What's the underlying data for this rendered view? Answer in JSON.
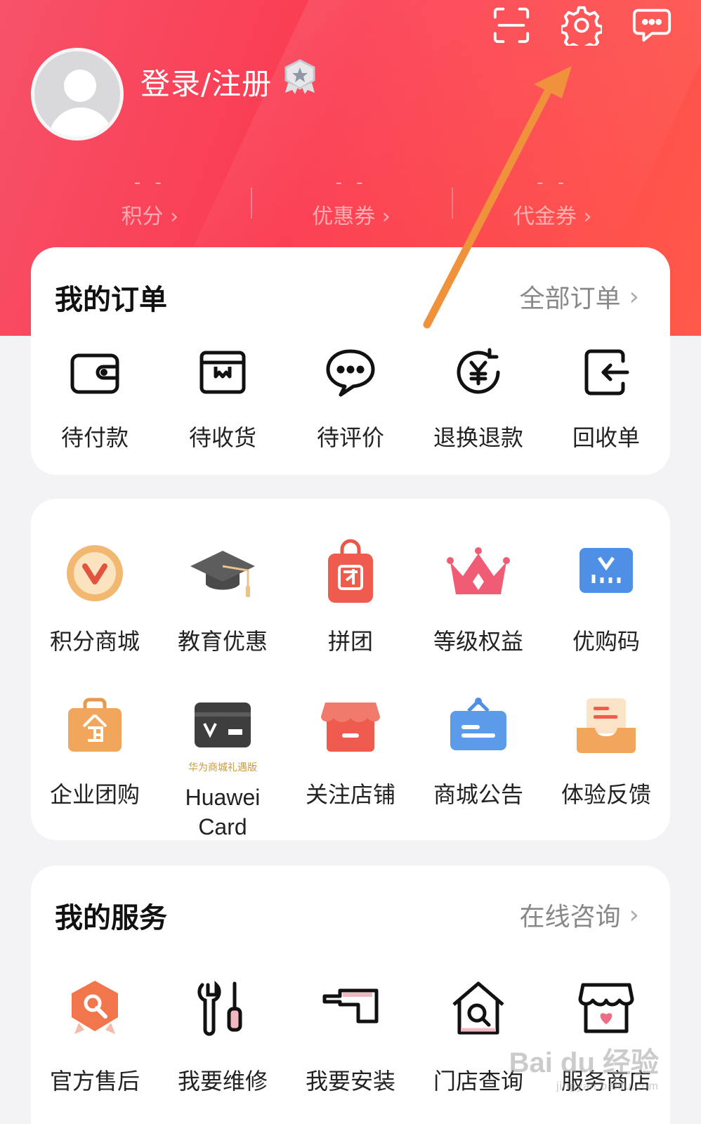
{
  "header": {
    "login_label": "登录/注册",
    "stats": [
      {
        "value": "- -",
        "label": "积分 ›"
      },
      {
        "value": "- -",
        "label": "优惠券 ›"
      },
      {
        "value": "- -",
        "label": "代金券 ›"
      }
    ],
    "icons": [
      "scan-icon",
      "gear-icon",
      "message-icon"
    ]
  },
  "orders": {
    "title": "我的订单",
    "link": "全部订单",
    "items": [
      {
        "label": "待付款",
        "icon": "wallet-icon"
      },
      {
        "label": "待收货",
        "icon": "package-icon"
      },
      {
        "label": "待评价",
        "icon": "comment-icon"
      },
      {
        "label": "退换退款",
        "icon": "refund-icon"
      },
      {
        "label": "回收单",
        "icon": "recycle-order-icon"
      }
    ]
  },
  "tools": {
    "row1": [
      {
        "label": "积分商城",
        "icon": "points-mall-icon"
      },
      {
        "label": "教育优惠",
        "icon": "graduation-cap-icon"
      },
      {
        "label": "拼团",
        "icon": "group-buy-bag-icon"
      },
      {
        "label": "等级权益",
        "icon": "crown-icon"
      },
      {
        "label": "优购码",
        "icon": "shopping-code-icon"
      }
    ],
    "row2": [
      {
        "label": "企业团购",
        "icon": "enterprise-bag-icon"
      },
      {
        "label": "Huawei Card",
        "sub": "华为商城礼遇版",
        "icon": "huawei-card-icon"
      },
      {
        "label": "关注店铺",
        "icon": "store-icon"
      },
      {
        "label": "商城公告",
        "icon": "notice-board-icon"
      },
      {
        "label": "体验反馈",
        "icon": "feedback-tray-icon"
      }
    ]
  },
  "services": {
    "title": "我的服务",
    "link": "在线咨询",
    "items": [
      {
        "label": "官方售后",
        "icon": "after-sales-icon"
      },
      {
        "label": "我要维修",
        "icon": "repair-tools-icon"
      },
      {
        "label": "我要安装",
        "icon": "install-icon"
      },
      {
        "label": "门店查询",
        "icon": "store-search-icon"
      },
      {
        "label": "服务商店",
        "icon": "service-shop-icon"
      }
    ]
  },
  "watermark": {
    "text": "Bai du 经验",
    "small": "jingyan.baidu.com"
  },
  "colors": {
    "accent": "#fb3a4f",
    "arrow": "#f0913c"
  }
}
